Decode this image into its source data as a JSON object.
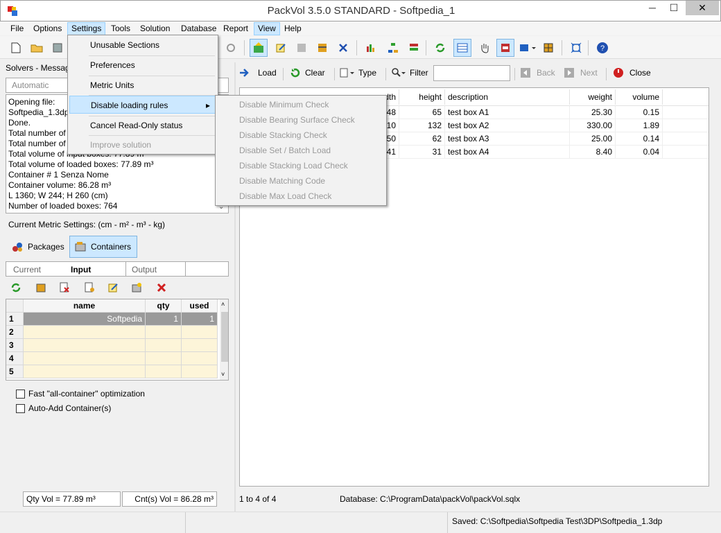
{
  "window": {
    "title": "PackVol 3.5.0 STANDARD - Softpedia_1",
    "minimize": "─",
    "maximize": "☐",
    "close": "✕"
  },
  "menubar": [
    "File",
    "Options",
    "Settings",
    "Tools",
    "Solution",
    "Database",
    "Report",
    "View",
    "Help"
  ],
  "settings_menu": {
    "items": [
      {
        "label": "Unusable Sections",
        "disabled": false
      },
      {
        "label": "Preferences",
        "disabled": false
      },
      {
        "label": "Metric Units",
        "disabled": false
      },
      {
        "label": "Disable loading rules",
        "disabled": false,
        "submenu_arrow": "▸"
      },
      {
        "label": "Cancel Read-Only status",
        "disabled": false
      },
      {
        "label": "Improve solution",
        "disabled": true
      }
    ]
  },
  "loading_rules_submenu": [
    "Disable Minimum Check",
    "Disable Bearing Surface Check",
    "Disable Stacking Check",
    "Disable Set / Batch Load",
    "Disable Stacking Load Check",
    "Disable Matching Code",
    "Disable Max Load Check"
  ],
  "solvers": {
    "header": "Solvers - Messag",
    "combo_value": "Automatic",
    "log": [
      "Opening file:",
      "Softpedia_1.3dp",
      "Done.",
      "Total number of",
      "Total number of",
      "Total volume of input boxes: 77.89 m",
      "Total volume of loaded boxes: 77.89 m³",
      "Container # 1 Senza Nome",
      "Container volume: 86.28 m³",
      "L 1360; W 244; H 260 (cm)",
      "Number of loaded boxes: 764"
    ]
  },
  "metric_settings": "Current Metric Settings: (cm - m² - m³ - kg)",
  "tabs": {
    "packages": "Packages",
    "containers": "Containers"
  },
  "subtabs": {
    "current": "Current",
    "input": "Input",
    "output": "Output"
  },
  "container_grid": {
    "headers": {
      "name": "name",
      "qty": "qty",
      "used": "used"
    },
    "rows": [
      {
        "num": "1",
        "name": "Softpedia",
        "qty": "1",
        "used": "1"
      },
      {
        "num": "2",
        "name": "",
        "qty": "",
        "used": ""
      },
      {
        "num": "3",
        "name": "",
        "qty": "",
        "used": ""
      },
      {
        "num": "4",
        "name": "",
        "qty": "",
        "used": ""
      },
      {
        "num": "5",
        "name": "",
        "qty": "",
        "used": ""
      }
    ]
  },
  "options": {
    "fast": "Fast \"all-container\" optimization",
    "auto_add": "Auto-Add Container(s)"
  },
  "qty_vol": "Qty Vol = 77.89 m³",
  "cnt_vol": "Cnt(s) Vol = 86.28 m³",
  "db_toolbar": {
    "load": "Load",
    "clear": "Clear",
    "type": "Type",
    "filter": "Filter",
    "filter_value": "",
    "back": "Back",
    "next": "Next",
    "close": "Close"
  },
  "packages_table": {
    "headers": {
      "height": "height",
      "description": "description",
      "weight": "weight",
      "volume": "volume"
    },
    "rows": [
      {
        "width_tail": "48",
        "height": "65",
        "description": "test box A1",
        "weight": "25.30",
        "volume": "0.15"
      },
      {
        "width_tail": "10",
        "height": "132",
        "description": "test box A2",
        "weight": "330.00",
        "volume": "1.89"
      },
      {
        "width_tail": "50",
        "height": "62",
        "description": "test box A3",
        "weight": "25.00",
        "volume": "0.14"
      },
      {
        "width_tail": "41",
        "height": "31",
        "description": "test box A4",
        "weight": "8.40",
        "volume": "0.04"
      }
    ],
    "partial_header": "dth"
  },
  "record_count": "1 to 4 of 4",
  "database_path": "Database: C:\\ProgramData\\packVol\\packVol.sqlx",
  "saved_path": "Saved: C:\\Softpedia\\Softpedia Test\\3DP\\Softpedia_1.3dp"
}
